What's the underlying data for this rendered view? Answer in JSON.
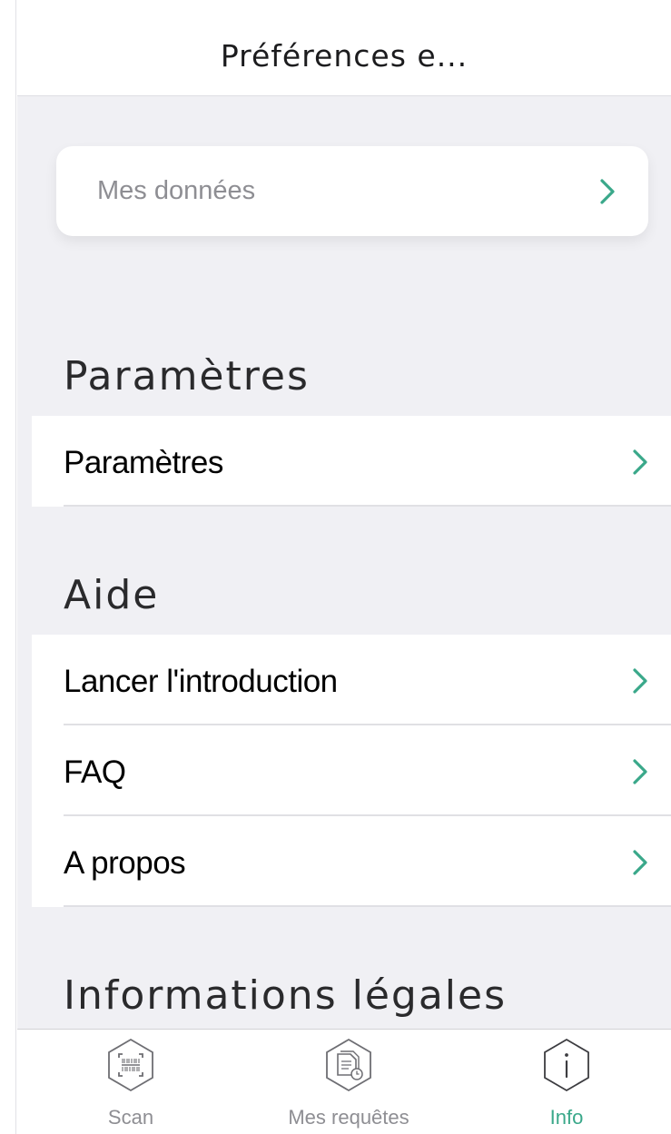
{
  "header": {
    "title": "Préférences e..."
  },
  "account_card": {
    "label": "Mes données"
  },
  "sections": {
    "settings": {
      "title": "Paramètres",
      "items": [
        {
          "label": "Paramètres"
        }
      ]
    },
    "help": {
      "title": "Aide",
      "items": [
        {
          "label": "Lancer l'introduction"
        },
        {
          "label": "FAQ"
        },
        {
          "label": "A propos"
        }
      ]
    },
    "legal": {
      "title": "Informations légales"
    }
  },
  "tabbar": {
    "tabs": [
      {
        "label": "Scan",
        "icon": "barcode-scan-icon",
        "active": false
      },
      {
        "label": "Mes requêtes",
        "icon": "document-history-icon",
        "active": false
      },
      {
        "label": "Info",
        "icon": "info-icon",
        "active": true
      }
    ]
  },
  "colors": {
    "accent": "#3aa88a",
    "background": "#f0f0f4",
    "secondary_text": "#8e8e93"
  },
  "icons": {
    "row_chevron": "chevron-right-icon"
  }
}
